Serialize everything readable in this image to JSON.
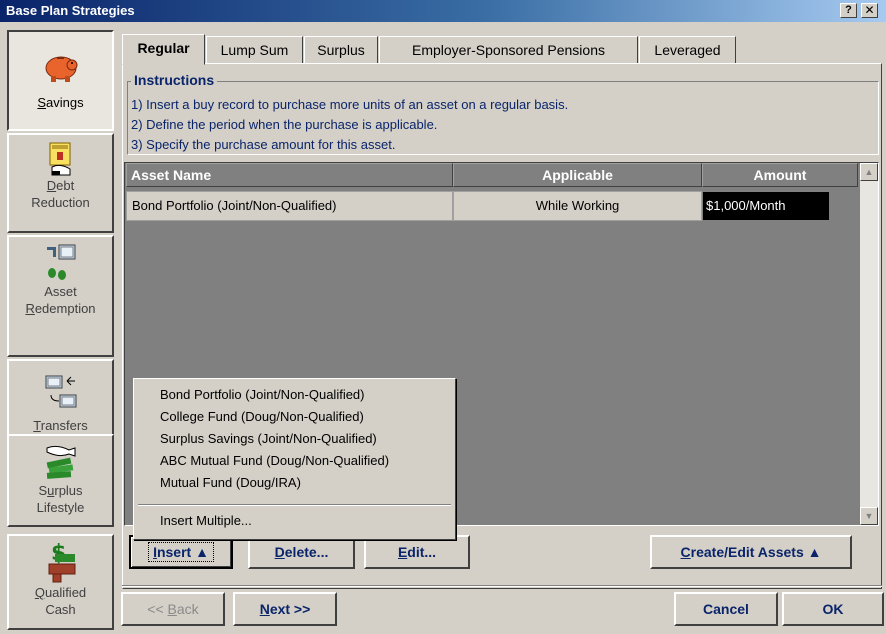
{
  "window": {
    "title": "Base Plan Strategies",
    "help_label": "?",
    "close_label": "✕"
  },
  "sidebar": {
    "items": [
      {
        "label_pre": "",
        "label_u": "S",
        "label_post": "avings"
      },
      {
        "line1_u": "D",
        "line1_post": "ebt",
        "line2": "Reduction"
      },
      {
        "line1": "Asset",
        "line2_u": "R",
        "line2_post": "edemption"
      },
      {
        "label_u": "T",
        "label_post": "ransfers"
      },
      {
        "line1_pre": "S",
        "line1_u": "u",
        "line1_post": "rplus",
        "line2": "Lifestyle"
      },
      {
        "line1_u": "Q",
        "line1_post": "ualified",
        "line2": "Cash"
      }
    ]
  },
  "tabs": [
    "Regular",
    "Lump Sum",
    "Surplus",
    "Employer-Sponsored Pensions",
    "Leveraged"
  ],
  "instructions": {
    "title": "Instructions",
    "lines": [
      "1) Insert a buy record to purchase more units of an asset on a regular basis.",
      "2) Define the period when the purchase is applicable.",
      "3) Specify the purchase amount for this asset."
    ]
  },
  "grid": {
    "columns": [
      "Asset Name",
      "Applicable",
      "Amount"
    ],
    "rows": [
      {
        "asset_name": "Bond Portfolio  (Joint/Non-Qualified)",
        "applicable": "While Working",
        "amount": "$1,000/Month"
      }
    ]
  },
  "popup_menu": {
    "items": [
      "Bond Portfolio (Joint/Non-Qualified)",
      "College Fund (Doug/Non-Qualified)",
      "Surplus Savings (Joint/Non-Qualified)",
      "ABC Mutual Fund (Doug/Non-Qualified)",
      "Mutual Fund (Doug/IRA)"
    ],
    "extra_item": "Insert Multiple..."
  },
  "buttons": {
    "insert_u": "I",
    "insert_post": "nsert ▲",
    "delete_u": "D",
    "delete_post": "elete...",
    "edit_u": "E",
    "edit_post": "dit...",
    "create_edit_u": "C",
    "create_edit_post": "reate/Edit Assets ▲",
    "back_pre": "<< ",
    "back_u": "B",
    "back_post": "ack",
    "next_u": "N",
    "next_post": "ext >>",
    "cancel": "Cancel",
    "ok": "OK"
  },
  "colors": {
    "accent_text": "#0a246a",
    "grid_bg": "#808080",
    "selected_cell_bg": "#000000"
  }
}
